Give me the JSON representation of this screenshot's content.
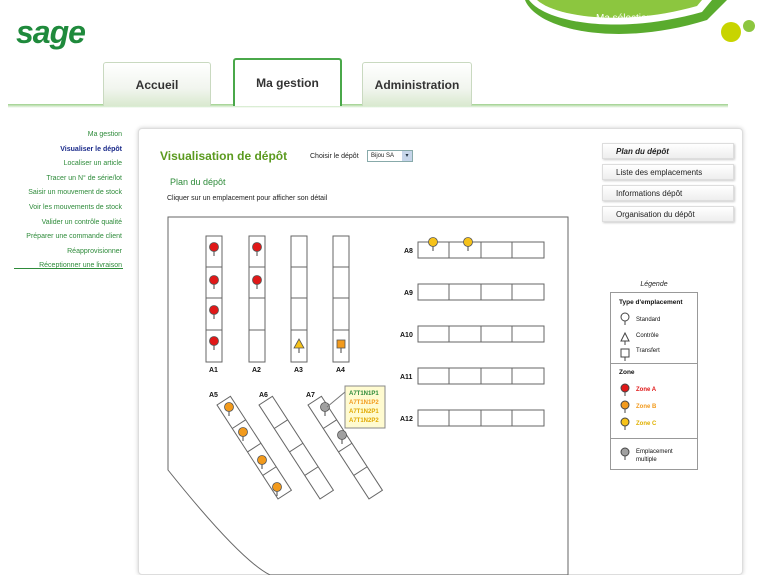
{
  "brand": {
    "logo": "sage",
    "my_selection": "Ma sélection"
  },
  "tabs": [
    {
      "label": "Accueil"
    },
    {
      "label": "Ma gestion"
    },
    {
      "label": "Administration"
    }
  ],
  "leftnav": [
    {
      "label": "Ma gestion"
    },
    {
      "label": "Visualiser le dépôt"
    },
    {
      "label": "Localiser un article"
    },
    {
      "label": "Tracer un N° de série/lot"
    },
    {
      "label": "Saisir un mouvement de stock"
    },
    {
      "label": "Voir les mouvements de stock"
    },
    {
      "label": "Valider un contrôle qualité"
    },
    {
      "label": "Préparer une commande client"
    },
    {
      "label": "Réapprovisionner"
    },
    {
      "label": "Réceptionner une livraison"
    }
  ],
  "main": {
    "title": "Visualisation de dépôt",
    "choose_label": "Choisir le dépôt",
    "depot_value": "Bijou SA",
    "plan_title": "Plan du dépôt",
    "instruction": "Cliquer sur un emplacement pour afficher son détail"
  },
  "rightmenu": [
    {
      "label": "Plan du dépôt"
    },
    {
      "label": "Liste des emplacements"
    },
    {
      "label": "Informations dépôt"
    },
    {
      "label": "Organisation du dépôt"
    }
  ],
  "map": {
    "aisles": [
      "A1",
      "A2",
      "A3",
      "A4",
      "A5",
      "A6",
      "A7",
      "A8",
      "A9",
      "A10",
      "A11",
      "A12"
    ],
    "tooltip": [
      "A7T1N1P1",
      "A7T1N1P2",
      "A7T1N2P1",
      "A7T1N2P2"
    ]
  },
  "legend": {
    "title": "Légende",
    "type_header": "Type d'emplacement",
    "types": [
      "Standard",
      "Contrôle",
      "Transfert"
    ],
    "zone_header": "Zone",
    "zones": [
      "Zone A",
      "Zone B",
      "Zone C"
    ],
    "multiple": "Emplacement multiple"
  },
  "colors": {
    "red": "#e01818",
    "orange": "#f29a1c",
    "yellow": "#f6c21a",
    "grey": "#a0a0a0",
    "green": "#2e8b3a"
  }
}
